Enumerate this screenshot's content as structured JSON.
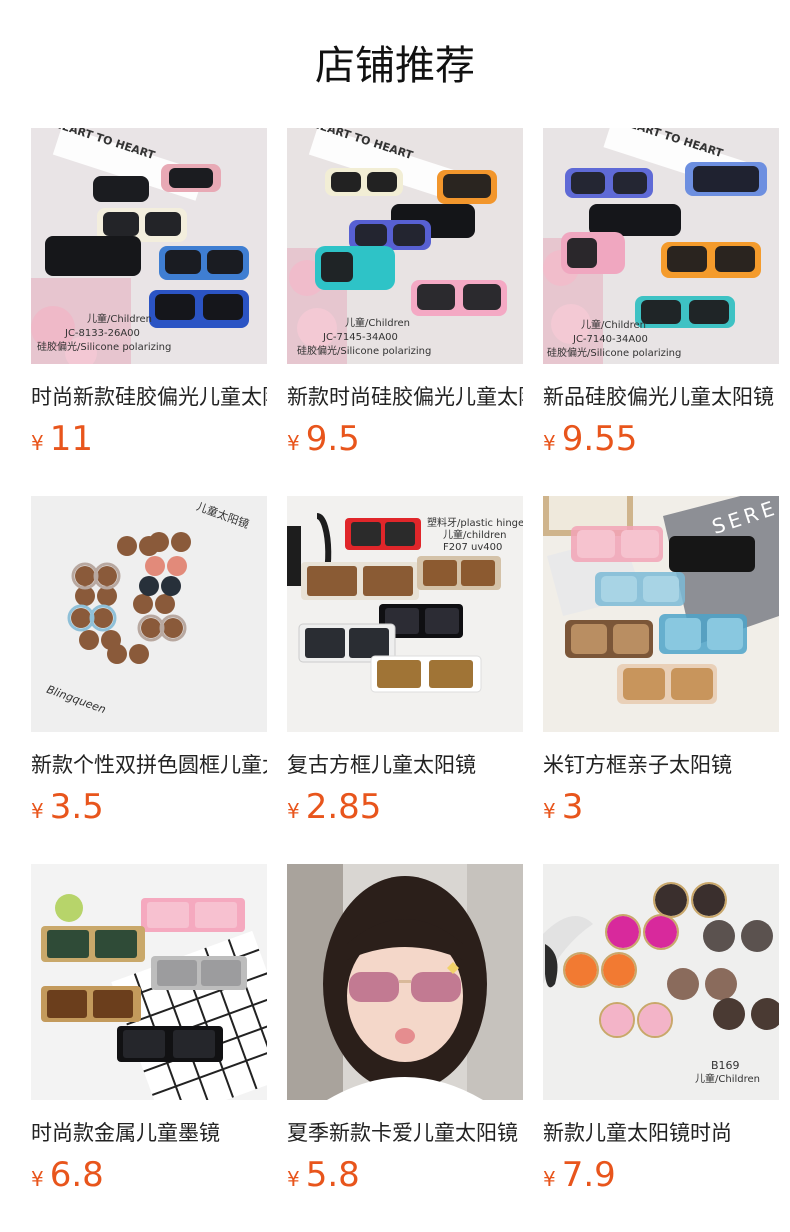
{
  "header": {
    "title": "店铺推荐"
  },
  "currency_symbol": "¥",
  "products": [
    {
      "title": "时尚新款硅胶偏光儿童太阳镜",
      "price": "11",
      "image_labels": [
        "HEART TO HEART",
        "儿童/Children",
        "JC-8133-26A00",
        "硅胶偏光/Silicone polarizing"
      ]
    },
    {
      "title": "新款时尚硅胶偏光儿童太阳镜",
      "price": "9.5",
      "image_labels": [
        "HEART TO HEART",
        "儿童/Children",
        "JC-7145-34A00",
        "硅胶偏光/Silicone polarizing"
      ]
    },
    {
      "title": "新品硅胶偏光儿童太阳镜",
      "price": "9.55",
      "image_labels": [
        "HEART TO HEART",
        "儿童/Children",
        "JC-7140-34A00",
        "硅胶偏光/Silicone polarizing"
      ]
    },
    {
      "title": "新款个性双拼色圆框儿童太阳镜",
      "price": "3.5",
      "image_labels": [
        "儿童太阳镜",
        "Blingqueen"
      ]
    },
    {
      "title": "复古方框儿童太阳镜",
      "price": "2.85",
      "image_labels": [
        "塑料牙/plastic hinge",
        "儿童/children",
        "F207  uv400"
      ]
    },
    {
      "title": "米钉方框亲子太阳镜",
      "price": "3",
      "image_labels": [
        "SERE"
      ]
    },
    {
      "title": "时尚款金属儿童墨镜",
      "price": "6.8",
      "image_labels": []
    },
    {
      "title": "夏季新款卡爱儿童太阳镜",
      "price": "5.8",
      "image_labels": []
    },
    {
      "title": "新款儿童太阳镜时尚",
      "price": "7.9",
      "image_labels": [
        "B169",
        "儿童/Children"
      ]
    }
  ],
  "colors": {
    "price": "#e8551c",
    "title_text": "#222222"
  }
}
